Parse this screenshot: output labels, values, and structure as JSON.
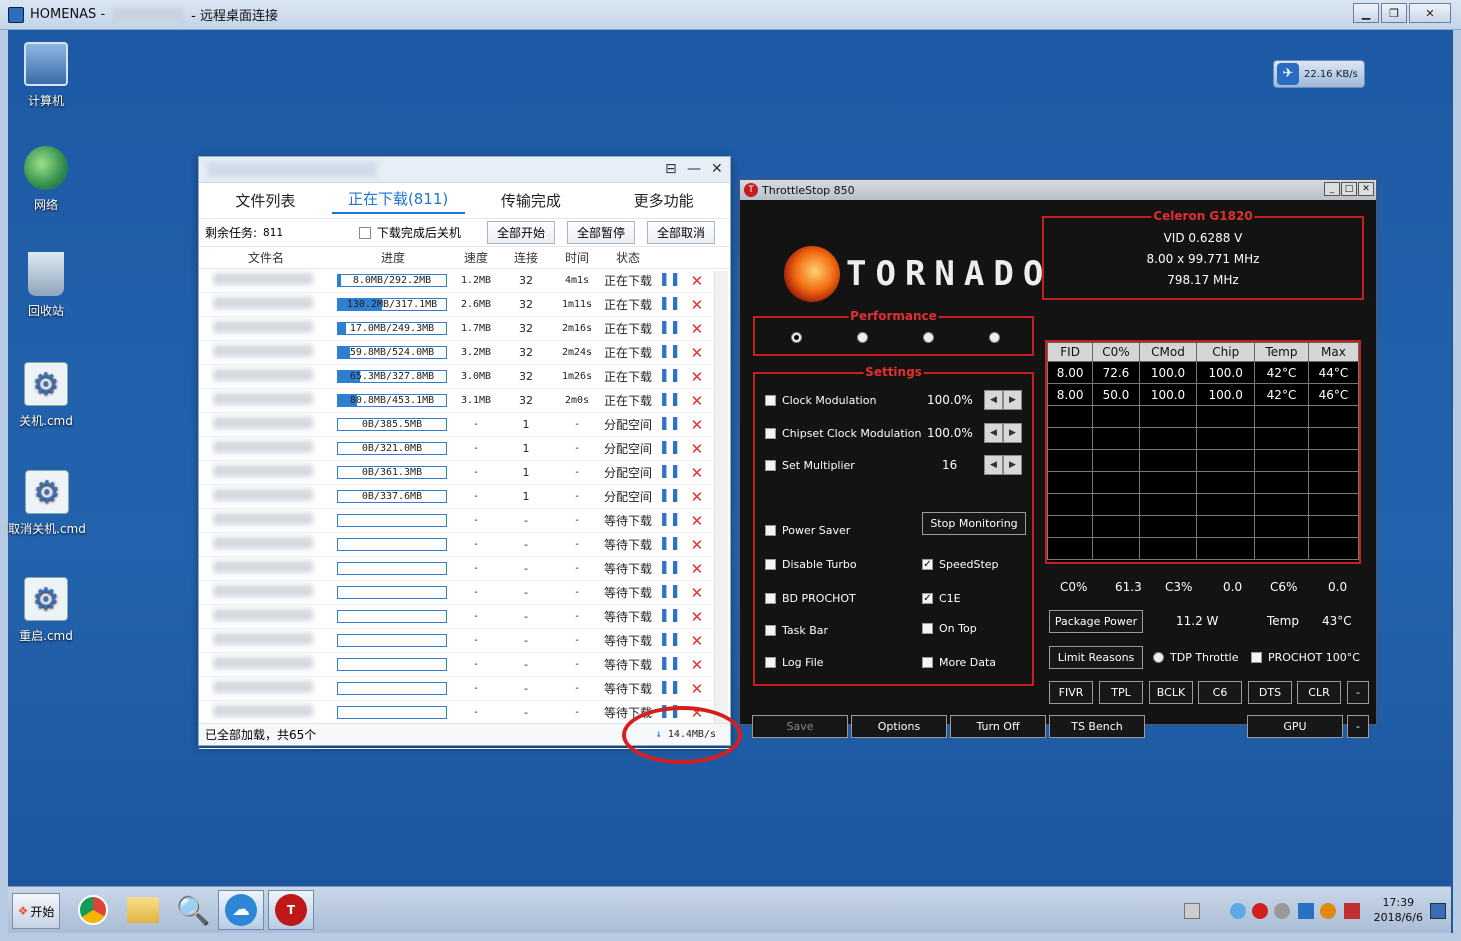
{
  "rdp": {
    "title_left": "HOMENAS -",
    "title_right": "- 远程桌面连接"
  },
  "desktop_icons": [
    {
      "label": "计算机",
      "icon": "computer-icon"
    },
    {
      "label": "网络",
      "icon": "network-icon"
    },
    {
      "label": "回收站",
      "icon": "recycle-bin-icon"
    },
    {
      "label": "关机.cmd",
      "icon": "cmd-file-icon"
    },
    {
      "label": "取消关机.cmd",
      "icon": "cmd-file-icon"
    },
    {
      "label": "重启.cmd",
      "icon": "cmd-file-icon"
    }
  ],
  "net_widget": {
    "speed": "22.16 KB/s"
  },
  "downloader": {
    "tabs": [
      "文件列表",
      "正在下载(811)",
      "传输完成",
      "更多功能"
    ],
    "remaining_label": "剩余任务:",
    "remaining_count": "811",
    "shutdown_label": "下载完成后关机",
    "btn_start_all": "全部开始",
    "btn_pause_all": "全部暂停",
    "btn_cancel_all": "全部取消",
    "columns": [
      "文件名",
      "进度",
      "速度",
      "连接",
      "时间",
      "状态"
    ],
    "rows": [
      {
        "progress": "8.0MB/292.2MB",
        "fill": 0.03,
        "speed": "1.2MB",
        "conn": "32",
        "time": "4m1s",
        "status": "正在下载"
      },
      {
        "progress": "130.2MB/317.1MB",
        "fill": 0.41,
        "speed": "2.6MB",
        "conn": "32",
        "time": "1m11s",
        "status": "正在下载"
      },
      {
        "progress": "17.0MB/249.3MB",
        "fill": 0.07,
        "speed": "1.7MB",
        "conn": "32",
        "time": "2m16s",
        "status": "正在下载"
      },
      {
        "progress": "59.8MB/524.0MB",
        "fill": 0.11,
        "speed": "3.2MB",
        "conn": "32",
        "time": "2m24s",
        "status": "正在下载"
      },
      {
        "progress": "65.3MB/327.8MB",
        "fill": 0.2,
        "speed": "3.0MB",
        "conn": "32",
        "time": "1m26s",
        "status": "正在下载"
      },
      {
        "progress": "80.8MB/453.1MB",
        "fill": 0.18,
        "speed": "3.1MB",
        "conn": "32",
        "time": "2m0s",
        "status": "正在下载"
      },
      {
        "progress": "0B/385.5MB",
        "fill": 0,
        "speed": "-",
        "conn": "1",
        "time": "-",
        "status": "分配空间"
      },
      {
        "progress": "0B/321.0MB",
        "fill": 0,
        "speed": "-",
        "conn": "1",
        "time": "-",
        "status": "分配空间"
      },
      {
        "progress": "0B/361.3MB",
        "fill": 0,
        "speed": "-",
        "conn": "1",
        "time": "-",
        "status": "分配空间"
      },
      {
        "progress": "0B/337.6MB",
        "fill": 0,
        "speed": "-",
        "conn": "1",
        "time": "-",
        "status": "分配空间"
      },
      {
        "progress": "",
        "fill": 0,
        "speed": "-",
        "conn": "-",
        "time": "-",
        "status": "等待下载"
      },
      {
        "progress": "",
        "fill": 0,
        "speed": "-",
        "conn": "-",
        "time": "-",
        "status": "等待下载"
      },
      {
        "progress": "",
        "fill": 0,
        "speed": "-",
        "conn": "-",
        "time": "-",
        "status": "等待下载"
      },
      {
        "progress": "",
        "fill": 0,
        "speed": "-",
        "conn": "-",
        "time": "-",
        "status": "等待下载"
      },
      {
        "progress": "",
        "fill": 0,
        "speed": "-",
        "conn": "-",
        "time": "-",
        "status": "等待下载"
      },
      {
        "progress": "",
        "fill": 0,
        "speed": "-",
        "conn": "-",
        "time": "-",
        "status": "等待下载"
      },
      {
        "progress": "",
        "fill": 0,
        "speed": "-",
        "conn": "-",
        "time": "-",
        "status": "等待下载"
      },
      {
        "progress": "",
        "fill": 0,
        "speed": "-",
        "conn": "-",
        "time": "-",
        "status": "等待下载"
      },
      {
        "progress": "",
        "fill": 0,
        "speed": "-",
        "conn": "-",
        "time": "-",
        "status": "等待下载"
      },
      {
        "progress": "",
        "fill": 0,
        "speed": "-",
        "conn": "-",
        "time": "-",
        "status": "等待下载"
      }
    ],
    "footer": "已全部加载，共65个",
    "total_speed": "14.4MB/s"
  },
  "throttlestop": {
    "title": "ThrottleStop 850",
    "logo": "TORNADO",
    "cpu_name": "Celeron G1820",
    "vid": "VID  0.6288 V",
    "multiplier": "8.00 x 99.771 MHz",
    "freq": "798.17 MHz",
    "performance_label": "Performance",
    "settings_label": "Settings",
    "clock_mod": {
      "label": "Clock Modulation",
      "value": "100.0%"
    },
    "chipset_mod": {
      "label": "Chipset Clock Modulation",
      "value": "100.0%"
    },
    "set_mult": {
      "label": "Set Multiplier",
      "value": "16"
    },
    "power_saver": "Power Saver",
    "stop_monitoring": "Stop Monitoring",
    "disable_turbo": "Disable Turbo",
    "speedstep": "SpeedStep",
    "bd_prochot": "BD PROCHOT",
    "c1e": "C1E",
    "task_bar": "Task Bar",
    "on_top": "On Top",
    "log_file": "Log File",
    "more_data": "More Data",
    "table_headers": [
      "FID",
      "C0%",
      "CMod",
      "Chip",
      "Temp",
      "Max"
    ],
    "table_rows": [
      [
        "8.00",
        "72.6",
        "100.0",
        "100.0",
        "42°C",
        "44°C"
      ],
      [
        "8.00",
        "50.0",
        "100.0",
        "100.0",
        "42°C",
        "46°C"
      ]
    ],
    "c0_label": "C0%",
    "c0_val": "61.3",
    "c3_label": "C3%",
    "c3_val": "0.0",
    "c6_label": "C6%",
    "c6_val": "0.0",
    "package_power": "Package Power",
    "power_val": "11.2 W",
    "temp_label": "Temp",
    "temp_val": "43°C",
    "limit_reasons": "Limit Reasons",
    "tdp_throttle": "TDP Throttle",
    "prochot": "PROCHOT 100°C",
    "row_btns": [
      "FIVR",
      "TPL",
      "BCLK",
      "C6",
      "DTS",
      "CLR",
      "-"
    ],
    "bottom_btns": [
      "Save",
      "Options",
      "Turn Off",
      "TS Bench",
      "GPU",
      "-"
    ]
  },
  "taskbar": {
    "start": "开始",
    "time": "17:39",
    "date": "2018/6/6"
  }
}
